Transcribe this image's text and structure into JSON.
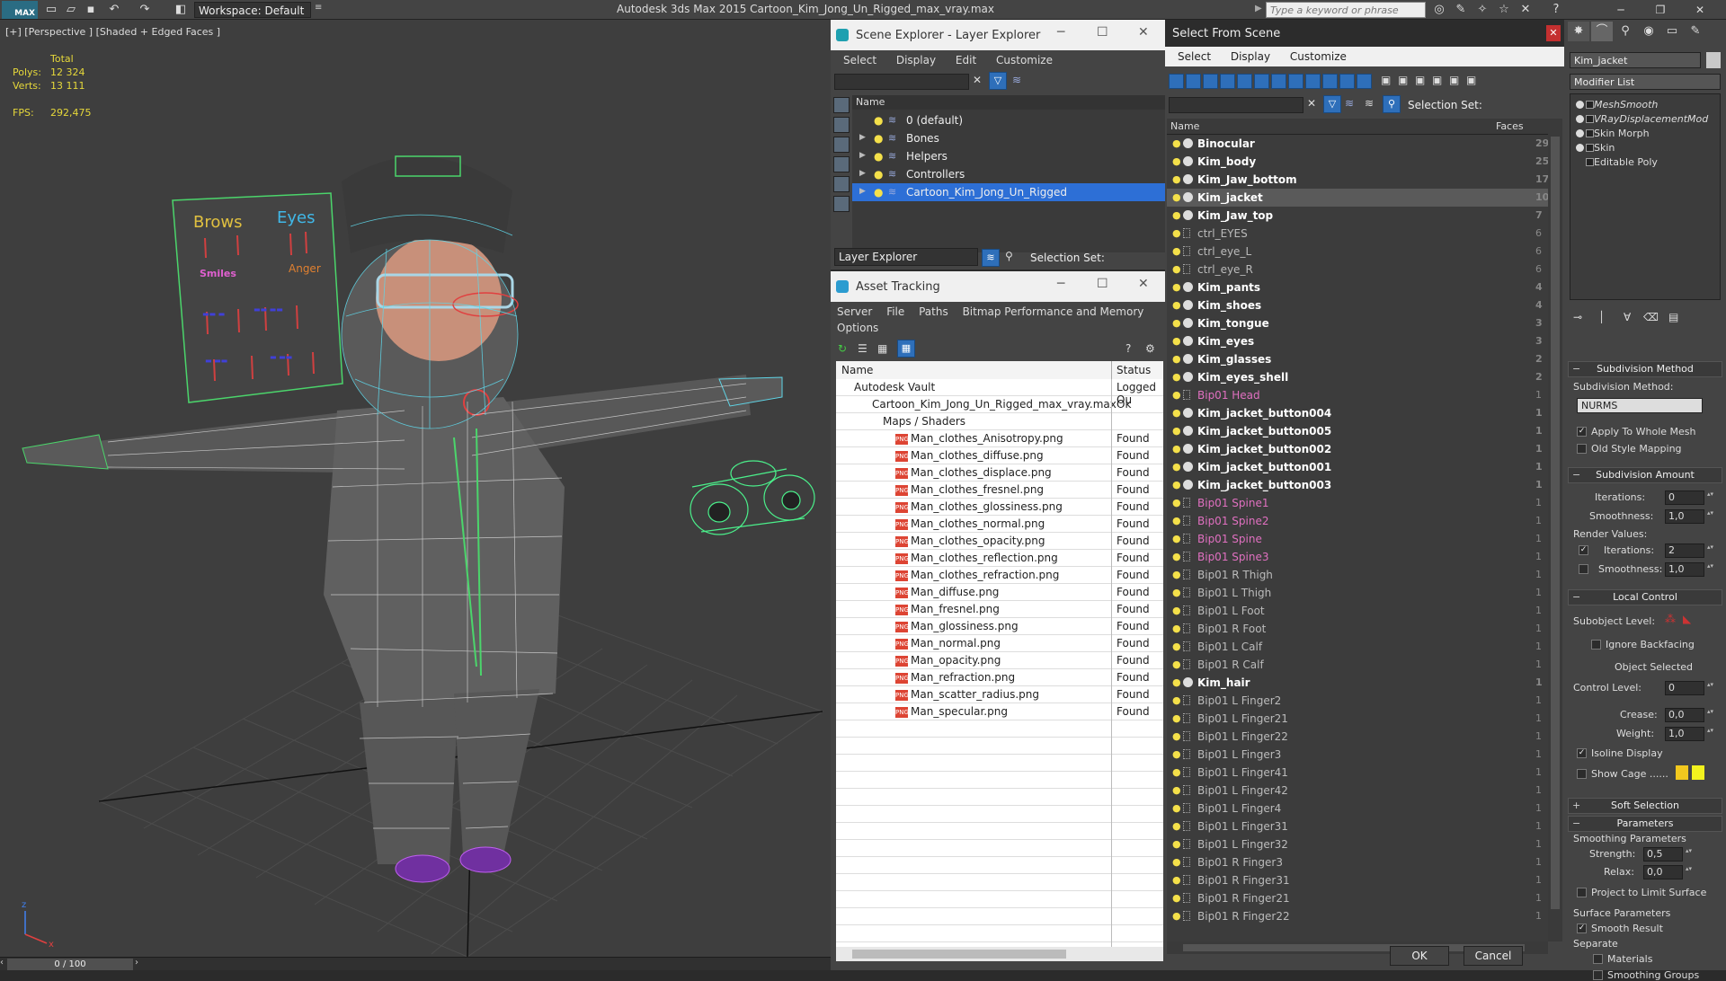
{
  "titlebar": {
    "app_title": "Autodesk 3ds Max  2015    Cartoon_Kim_Jong_Un_Rigged_max_vray.max",
    "workspace": "Workspace: Default",
    "logo": "MAX",
    "search_placeholder": "Type a keyword or phrase"
  },
  "viewport": {
    "label": "[+] [Perspective ] [Shaded + Edged Faces ]",
    "stats_header": "Total",
    "polys_label": "Polys:",
    "polys": "12 324",
    "verts_label": "Verts:",
    "verts": "13 111",
    "fps_label": "FPS:",
    "fps": "292,475",
    "frame": "0 / 100",
    "board": {
      "brows": "Brows",
      "eyes": "Eyes",
      "smiles": "Smiles",
      "anger": "Anger"
    }
  },
  "scene_explorer": {
    "title": "Scene Explorer - Layer Explorer",
    "menu": [
      "Select",
      "Display",
      "Edit",
      "Customize"
    ],
    "column": "Name",
    "layers": [
      {
        "name": "0 (default)",
        "expand": ""
      },
      {
        "name": "Bones",
        "expand": "▶"
      },
      {
        "name": "Helpers",
        "expand": "▶"
      },
      {
        "name": "Controllers",
        "expand": "▶"
      },
      {
        "name": "Cartoon_Kim_Jong_Un_Rigged",
        "expand": "▶"
      }
    ],
    "footer_dropdown": "Layer Explorer",
    "selection_set_label": "Selection Set:"
  },
  "asset_tracking": {
    "title": "Asset Tracking",
    "menu": [
      "Server",
      "File",
      "Paths",
      "Bitmap Performance and Memory"
    ],
    "menu2": "Options",
    "col_name": "Name",
    "col_status": "Status",
    "rows": [
      {
        "name": "Autodesk Vault",
        "status": "Logged Ou"
      },
      {
        "name": "Cartoon_Kim_Jong_Un_Rigged_max_vray.max",
        "status": "Ok"
      },
      {
        "name": "Maps / Shaders",
        "status": ""
      },
      {
        "name": "Man_clothes_Anisotropy.png",
        "status": "Found"
      },
      {
        "name": "Man_clothes_diffuse.png",
        "status": "Found"
      },
      {
        "name": "Man_clothes_displace.png",
        "status": "Found"
      },
      {
        "name": "Man_clothes_fresnel.png",
        "status": "Found"
      },
      {
        "name": "Man_clothes_glossiness.png",
        "status": "Found"
      },
      {
        "name": "Man_clothes_normal.png",
        "status": "Found"
      },
      {
        "name": "Man_clothes_opacity.png",
        "status": "Found"
      },
      {
        "name": "Man_clothes_reflection.png",
        "status": "Found"
      },
      {
        "name": "Man_clothes_refraction.png",
        "status": "Found"
      },
      {
        "name": "Man_diffuse.png",
        "status": "Found"
      },
      {
        "name": "Man_fresnel.png",
        "status": "Found"
      },
      {
        "name": "Man_glossiness.png",
        "status": "Found"
      },
      {
        "name": "Man_normal.png",
        "status": "Found"
      },
      {
        "name": "Man_opacity.png",
        "status": "Found"
      },
      {
        "name": "Man_refraction.png",
        "status": "Found"
      },
      {
        "name": "Man_scatter_radius.png",
        "status": "Found"
      },
      {
        "name": "Man_specular.png",
        "status": "Found"
      }
    ],
    "png_badge": "PNG"
  },
  "select_from_scene": {
    "title": "Select From Scene",
    "menu": [
      "Select",
      "Display",
      "Customize"
    ],
    "selection_set_label": "Selection Set:",
    "col_name": "Name",
    "col_faces": "Faces",
    "rows": [
      {
        "name": "Binocular",
        "kind": "bold",
        "faces": "29"
      },
      {
        "name": "Kim_body",
        "kind": "bold",
        "faces": "25"
      },
      {
        "name": "Kim_Jaw_bottom",
        "kind": "bold",
        "faces": "17"
      },
      {
        "name": "Kim_jacket",
        "kind": "bold hl",
        "faces": "10"
      },
      {
        "name": "Kim_Jaw_top",
        "kind": "bold",
        "faces": "7"
      },
      {
        "name": "ctrl_EYES",
        "kind": "ctrl",
        "faces": "6"
      },
      {
        "name": "ctrl_eye_L",
        "kind": "ctrl",
        "faces": "6"
      },
      {
        "name": "ctrl_eye_R",
        "kind": "ctrl",
        "faces": "6"
      },
      {
        "name": "Kim_pants",
        "kind": "bold",
        "faces": "4"
      },
      {
        "name": "Kim_shoes",
        "kind": "bold",
        "faces": "4"
      },
      {
        "name": "Kim_tongue",
        "kind": "bold",
        "faces": "3"
      },
      {
        "name": "Kim_eyes",
        "kind": "bold",
        "faces": "3"
      },
      {
        "name": "Kim_glasses",
        "kind": "bold",
        "faces": "2"
      },
      {
        "name": "Kim_eyes_shell",
        "kind": "bold",
        "faces": "2"
      },
      {
        "name": "Bip01 Head",
        "kind": "bone",
        "faces": "1"
      },
      {
        "name": "Kim_jacket_button004",
        "kind": "bold",
        "faces": "1"
      },
      {
        "name": "Kim_jacket_button005",
        "kind": "bold",
        "faces": "1"
      },
      {
        "name": "Kim_jacket_button002",
        "kind": "bold",
        "faces": "1"
      },
      {
        "name": "Kim_jacket_button001",
        "kind": "bold",
        "faces": "1"
      },
      {
        "name": "Kim_jacket_button003",
        "kind": "bold",
        "faces": "1"
      },
      {
        "name": "Bip01 Spine1",
        "kind": "bone",
        "faces": "1"
      },
      {
        "name": "Bip01 Spine2",
        "kind": "bone",
        "faces": "1"
      },
      {
        "name": "Bip01 Spine",
        "kind": "bone",
        "faces": "1"
      },
      {
        "name": "Bip01 Spine3",
        "kind": "bone",
        "faces": "1"
      },
      {
        "name": "Bip01 R Thigh",
        "kind": "dim",
        "faces": "1"
      },
      {
        "name": "Bip01 L Thigh",
        "kind": "dim",
        "faces": "1"
      },
      {
        "name": "Bip01 L Foot",
        "kind": "dim",
        "faces": "1"
      },
      {
        "name": "Bip01 R Foot",
        "kind": "dim",
        "faces": "1"
      },
      {
        "name": "Bip01 L Calf",
        "kind": "dim",
        "faces": "1"
      },
      {
        "name": "Bip01 R Calf",
        "kind": "dim",
        "faces": "1"
      },
      {
        "name": "Kim_hair",
        "kind": "bold",
        "faces": "1"
      },
      {
        "name": "Bip01 L Finger2",
        "kind": "dim",
        "faces": "1"
      },
      {
        "name": "Bip01 L Finger21",
        "kind": "dim",
        "faces": "1"
      },
      {
        "name": "Bip01 L Finger22",
        "kind": "dim",
        "faces": "1"
      },
      {
        "name": "Bip01 L Finger3",
        "kind": "dim",
        "faces": "1"
      },
      {
        "name": "Bip01 L Finger41",
        "kind": "dim",
        "faces": "1"
      },
      {
        "name": "Bip01 L Finger42",
        "kind": "dim",
        "faces": "1"
      },
      {
        "name": "Bip01 L Finger4",
        "kind": "dim",
        "faces": "1"
      },
      {
        "name": "Bip01 L Finger31",
        "kind": "dim",
        "faces": "1"
      },
      {
        "name": "Bip01 L Finger32",
        "kind": "dim",
        "faces": "1"
      },
      {
        "name": "Bip01 R Finger3",
        "kind": "dim",
        "faces": "1"
      },
      {
        "name": "Bip01 R Finger31",
        "kind": "dim",
        "faces": "1"
      },
      {
        "name": "Bip01 R Finger21",
        "kind": "dim",
        "faces": "1"
      },
      {
        "name": "Bip01 R Finger22",
        "kind": "dim",
        "faces": "1"
      }
    ],
    "ok": "OK",
    "cancel": "Cancel"
  },
  "modify_panel": {
    "object_name": "Kim_jacket",
    "modifier_list": "Modifier List",
    "stack": [
      {
        "name": "MeshSmooth",
        "italic": true
      },
      {
        "name": "VRayDisplacementMod",
        "italic": true
      },
      {
        "name": "Skin Morph",
        "italic": false
      },
      {
        "name": "Skin",
        "italic": false
      },
      {
        "name": "Editable Poly",
        "italic": false
      }
    ],
    "subdivision_method_title": "Subdivision Method",
    "subdivision_method_label": "Subdivision Method:",
    "subdivision_method_value": "NURMS",
    "apply_whole_mesh": "Apply To Whole Mesh",
    "old_style_mapping": "Old Style Mapping",
    "subdivision_amount_title": "Subdivision Amount",
    "iterations_label": "Iterations:",
    "iterations": "0",
    "smoothness_label": "Smoothness:",
    "smoothness": "1,0",
    "render_values": "Render Values:",
    "render_iterations": "2",
    "render_smoothness": "1,0",
    "local_control_title": "Local Control",
    "subobject_level": "Subobject Level:",
    "ignore_backfacing": "Ignore Backfacing",
    "object_selected": "Object Selected",
    "control_level_label": "Control Level:",
    "control_level": "0",
    "crease_label": "Crease:",
    "crease": "0,0",
    "weight_label": "Weight:",
    "weight": "1,0",
    "isoline_display": "Isoline Display",
    "show_cage": "Show Cage ......",
    "cage_color_1": "#f2c81e",
    "cage_color_2": "#f2f21e",
    "soft_selection_title": "Soft Selection",
    "parameters_title": "Parameters",
    "smoothing_parameters": "Smoothing Parameters",
    "strength_label": "Strength:",
    "strength": "0,5",
    "relax_label": "Relax:",
    "relax": "0,0",
    "project_limit": "Project to Limit Surface",
    "surface_parameters": "Surface Parameters",
    "smooth_result": "Smooth Result",
    "separate": "Separate",
    "materials": "Materials",
    "smoothing_groups": "Smoothing Groups"
  },
  "colors": {
    "selection_blue": "#2d6fd6",
    "wire_cyan": "#5fd6e8",
    "bone_pink": "#e070c0",
    "stat_yellow": "#e6d83a"
  }
}
